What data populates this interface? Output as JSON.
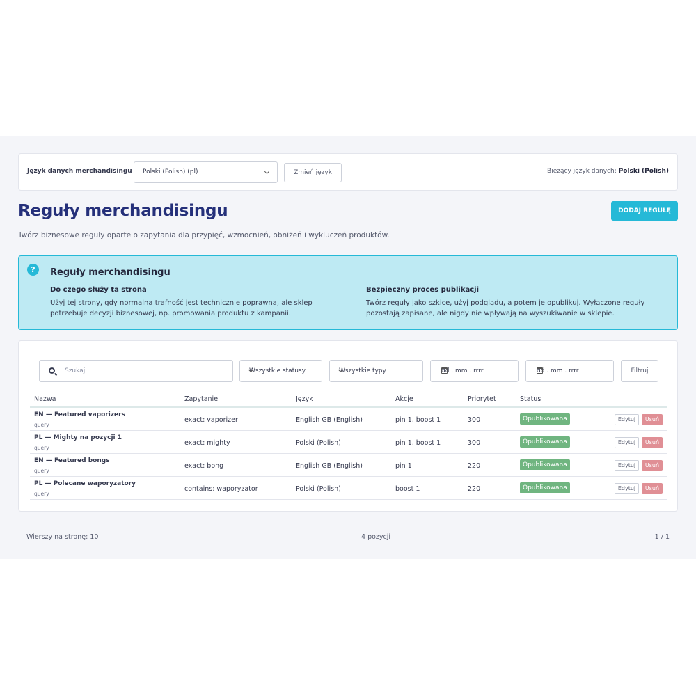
{
  "lang_bar": {
    "label": "Język danych merchandisingu",
    "selected": "Polski (Polish) (pl)",
    "change_button": "Zmień język",
    "current_prefix": "Bieżący język danych:",
    "current_value": "Polski (Polish)"
  },
  "header": {
    "title": "Reguły merchandisingu",
    "add_button": "DODAJ REGUŁĘ",
    "description": "Twórz biznesowe reguły oparte o zapytania dla przypięć, wzmocnień, obniżeń i wykluczeń produktów."
  },
  "info": {
    "icon": "?",
    "title": "Reguły merchandisingu",
    "col1_heading": "Do czego służy ta strona",
    "col1_text": "Użyj tej strony, gdy normalna trafność jest technicznie poprawna, ale sklep potrzebuje decyzji biznesowej, np. promowania produktu z kampanii.",
    "col2_heading": "Bezpieczny proces publikacji",
    "col2_text": "Twórz reguły jako szkice, użyj podglądu, a potem je opublikuj. Wyłączone reguły pozostają zapisane, ale nigdy nie wpływają na wyszukiwanie w sklepie."
  },
  "filters": {
    "search_placeholder": "Szukaj",
    "status": "Wszystkie statusy",
    "type": "Wszystkie typy",
    "date_from": "dd . mm . rrrr",
    "date_to": "dd . mm . rrrr",
    "filter_button": "Filtruj"
  },
  "table": {
    "columns": [
      "Nazwa",
      "Zapytanie",
      "Język",
      "Akcje",
      "Priorytet",
      "Status"
    ],
    "edit_label": "Edytuj",
    "delete_label": "Usuń",
    "rows": [
      {
        "name": "EN — Featured vaporizers",
        "type": "query",
        "query": "exact: vaporizer",
        "language": "English GB (English)",
        "actions": "pin 1, boost 1",
        "priority": "300",
        "status": "Opublikowana"
      },
      {
        "name": "PL — Mighty na pozycji 1",
        "type": "query",
        "query": "exact: mighty",
        "language": "Polski (Polish)",
        "actions": "pin 1, boost 1",
        "priority": "300",
        "status": "Opublikowana"
      },
      {
        "name": "EN — Featured bongs",
        "type": "query",
        "query": "exact: bong",
        "language": "English GB (English)",
        "actions": "pin 1",
        "priority": "220",
        "status": "Opublikowana"
      },
      {
        "name": "PL — Polecane waporyzatory",
        "type": "query",
        "query": "contains: waporyzator",
        "language": "Polski (Polish)",
        "actions": "boost 1",
        "priority": "220",
        "status": "Opublikowana"
      }
    ]
  },
  "footer": {
    "rows_per_page": "Wierszy na stronę: 10",
    "count": "4 pozycji",
    "pages": "1 / 1"
  },
  "colors": {
    "accent": "#25b9d7",
    "title": "#25307a",
    "success": "#70b580",
    "danger": "#e08f95"
  }
}
